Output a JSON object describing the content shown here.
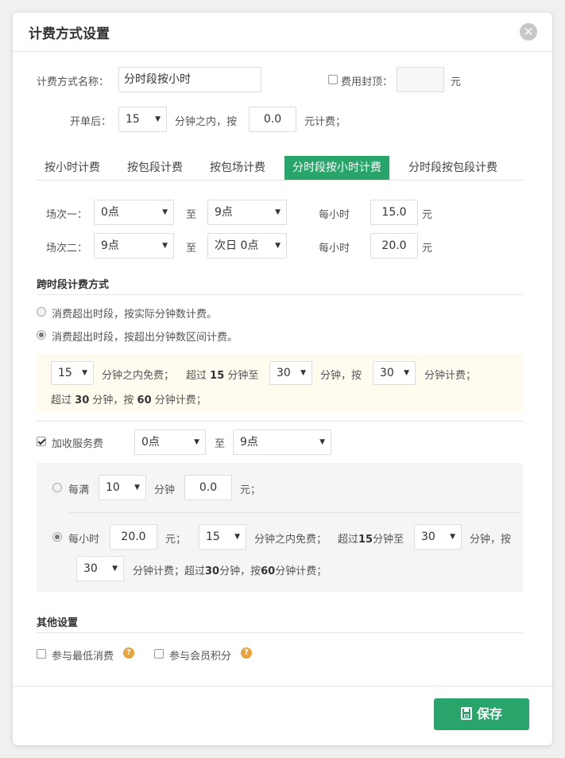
{
  "dialog": {
    "title": "计费方式设置"
  },
  "name_row": {
    "label": "计费方式名称：",
    "value": "分时段按小时",
    "cap_label": "费用封顶：",
    "cap_value": "",
    "cap_unit": "元"
  },
  "start_row": {
    "label": "开单后：",
    "minutes": "15",
    "mid_text": "分钟之内，按",
    "price": "0.0",
    "suffix": "元计费；"
  },
  "tabs": [
    "按小时计费",
    "按包段计费",
    "按包场计费",
    "分时段按小时计费",
    "分时段按包段计费"
  ],
  "active_tab": "分时段按小时计费",
  "sessions": [
    {
      "label": "场次一：",
      "from": "0点",
      "to_text": "至",
      "to": "9点",
      "per_label": "每小时",
      "price": "15.0",
      "unit": "元"
    },
    {
      "label": "场次二：",
      "from": "9点",
      "to_text": "至",
      "to": "次日 0点",
      "per_label": "每小时",
      "price": "20.0",
      "unit": "元"
    }
  ],
  "cross_section": {
    "heading": "跨时段计费方式",
    "option1": "消费超出时段，按实际分钟数计费。",
    "option2": "消费超出时段，按超出分钟数区间计费。",
    "free_minutes": "15",
    "text1": "分钟之内免费；",
    "text2_pre": "超过",
    "text2_num": "15",
    "text2_post": "分钟至",
    "to_minutes": "30",
    "text3": "分钟，按",
    "charge_minutes": "30",
    "text4": "分钟计费；",
    "line2_pre": "超过",
    "line2_num1": "30",
    "line2_mid": "分钟，按",
    "line2_num2": "60",
    "line2_post": "分钟计费；"
  },
  "service_fee": {
    "label": "加收服务费",
    "from": "0点",
    "to_text": "至",
    "to": "9点",
    "every_label": "每满",
    "every_minutes": "10",
    "every_unit": "分钟",
    "every_price": "0.0",
    "every_suffix": "元；",
    "hourly_label": "每小时",
    "hourly_price": "20.0",
    "hourly_unit": "元；",
    "free_minutes": "15",
    "free_text": "分钟之内免费；",
    "over_pre": "超过",
    "over_num": "15",
    "over_post": "分钟至",
    "to_minutes": "30",
    "by_text": "分钟，按",
    "charge_minutes": "30",
    "tail_pre": "分钟计费；超过",
    "tail_num1": "30",
    "tail_mid": "分钟，按",
    "tail_num2": "60",
    "tail_post": "分钟计费；"
  },
  "other": {
    "heading": "其他设置",
    "min_consume": "参与最低消费",
    "member_points": "参与会员积分"
  },
  "footer": {
    "save_label": "保存"
  },
  "colors": {
    "accent": "#29a56b",
    "help": "#e8a33d"
  }
}
